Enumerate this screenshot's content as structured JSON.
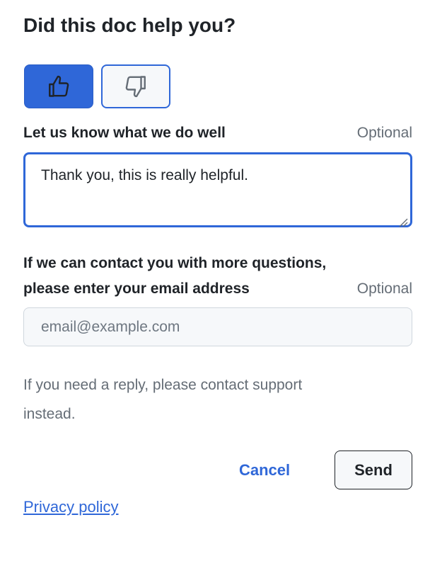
{
  "header": {
    "title": "Did this doc help you?"
  },
  "vote": {
    "selected": "thumbs-up",
    "up_icon": "thumbs-up-icon",
    "down_icon": "thumbs-down-icon",
    "selected_color": "#2f67d8"
  },
  "feedback": {
    "label": "Let us know what we do well",
    "optional": "Optional",
    "value": "Thank you, this is really helpful."
  },
  "contact": {
    "label_line1": "If we can contact you with more questions,",
    "label_line2": "please enter your email address",
    "optional": "Optional",
    "placeholder": "email@example.com"
  },
  "hint": {
    "line1": "If you need a reply, please contact support",
    "line2": "instead."
  },
  "actions": {
    "cancel_label": "Cancel",
    "send_label": "Send"
  },
  "footer": {
    "privacy_label": "Privacy policy"
  },
  "colors": {
    "accent": "#2f67d8",
    "text": "#1f2328",
    "muted": "#656d76"
  }
}
